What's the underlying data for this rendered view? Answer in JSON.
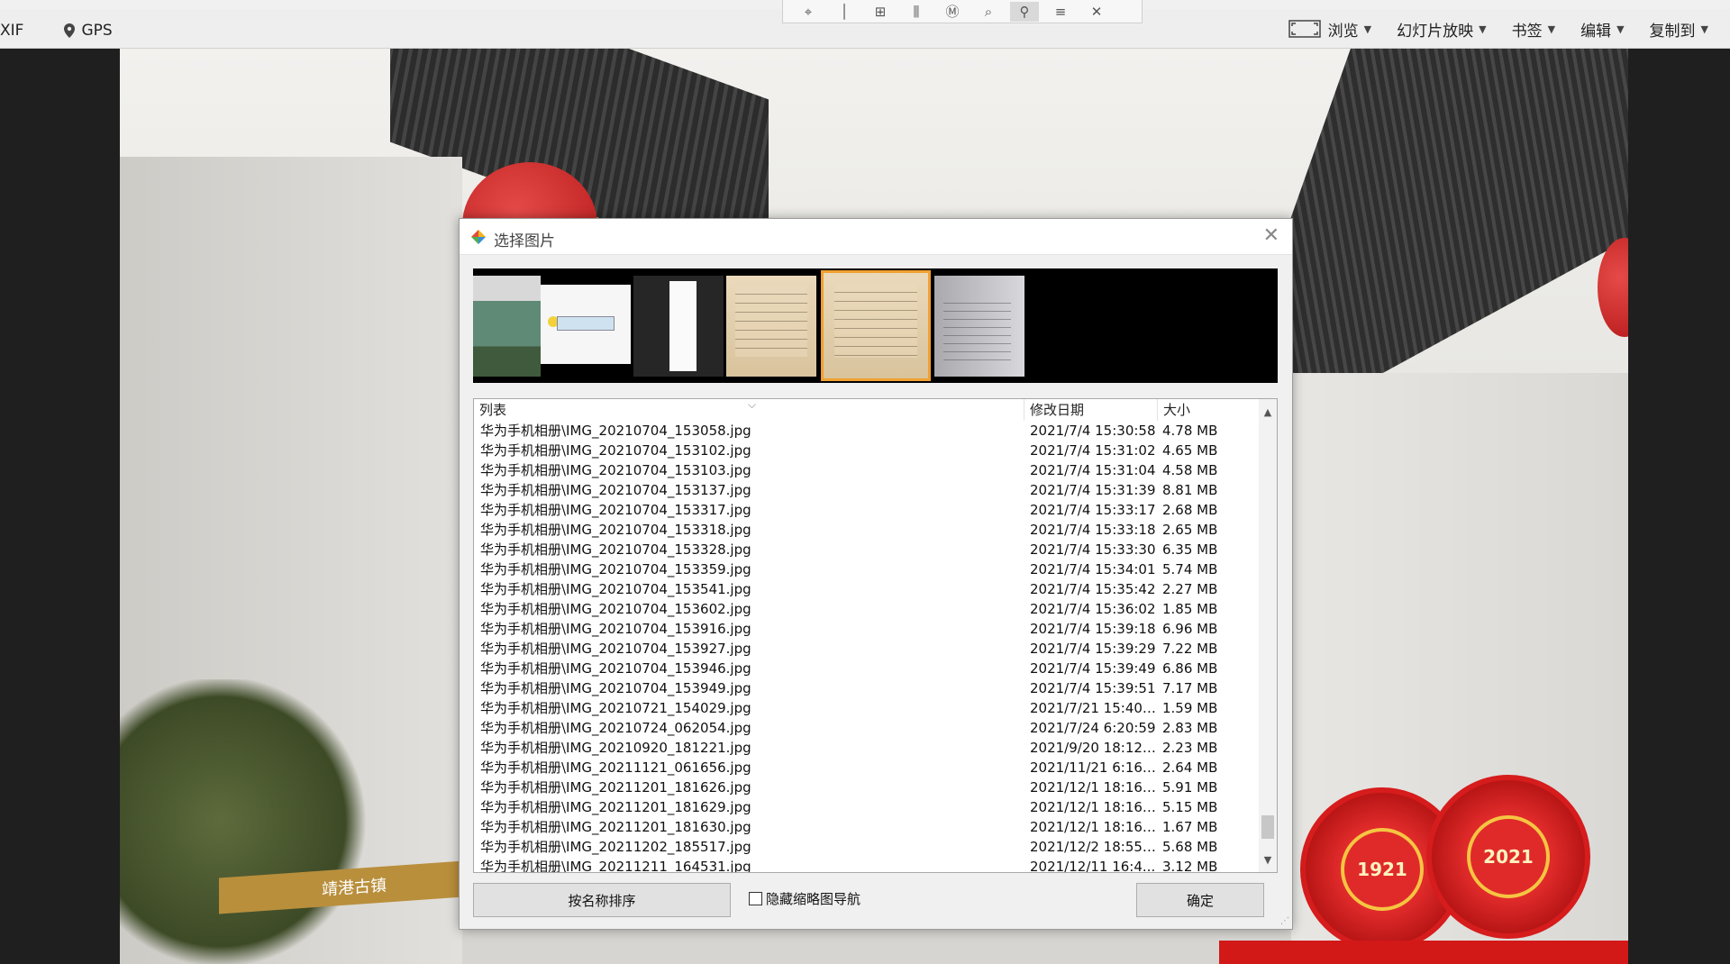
{
  "menubar": {
    "left_items": [
      {
        "label": "XIF",
        "icon": ""
      },
      {
        "label": "GPS",
        "icon": "pin-icon"
      }
    ],
    "right_items": [
      {
        "label": "浏览",
        "icon": "fullscreen-icon"
      },
      {
        "label": "幻灯片放映"
      },
      {
        "label": "书签"
      },
      {
        "label": "编辑"
      },
      {
        "label": "复制到"
      }
    ]
  },
  "toolbar_icons": [
    "crosshair-icon",
    "line-icon",
    "grid-icon",
    "bars-icon",
    "m-icon",
    "zoom-icon",
    "bike-icon",
    "menu-icon",
    "close-icon"
  ],
  "background_photo": {
    "sign_text": "靖港古镇",
    "wheel_years": [
      "1921",
      "2021"
    ]
  },
  "dialog": {
    "title": "选择图片",
    "list": {
      "headers": {
        "name": "列表",
        "date": "修改日期",
        "size": "大小"
      },
      "rows": [
        {
          "name": "华为手机相册\\IMG_20210704_153058.jpg",
          "date": "2021/7/4 15:30:58",
          "size": "4.78 MB"
        },
        {
          "name": "华为手机相册\\IMG_20210704_153102.jpg",
          "date": "2021/7/4 15:31:02",
          "size": "4.65 MB"
        },
        {
          "name": "华为手机相册\\IMG_20210704_153103.jpg",
          "date": "2021/7/4 15:31:04",
          "size": "4.58 MB"
        },
        {
          "name": "华为手机相册\\IMG_20210704_153137.jpg",
          "date": "2021/7/4 15:31:39",
          "size": "8.81 MB"
        },
        {
          "name": "华为手机相册\\IMG_20210704_153317.jpg",
          "date": "2021/7/4 15:33:17",
          "size": "2.68 MB"
        },
        {
          "name": "华为手机相册\\IMG_20210704_153318.jpg",
          "date": "2021/7/4 15:33:18",
          "size": "2.65 MB"
        },
        {
          "name": "华为手机相册\\IMG_20210704_153328.jpg",
          "date": "2021/7/4 15:33:30",
          "size": "6.35 MB"
        },
        {
          "name": "华为手机相册\\IMG_20210704_153359.jpg",
          "date": "2021/7/4 15:34:01",
          "size": "5.74 MB"
        },
        {
          "name": "华为手机相册\\IMG_20210704_153541.jpg",
          "date": "2021/7/4 15:35:42",
          "size": "2.27 MB"
        },
        {
          "name": "华为手机相册\\IMG_20210704_153602.jpg",
          "date": "2021/7/4 15:36:02",
          "size": "1.85 MB"
        },
        {
          "name": "华为手机相册\\IMG_20210704_153916.jpg",
          "date": "2021/7/4 15:39:18",
          "size": "6.96 MB"
        },
        {
          "name": "华为手机相册\\IMG_20210704_153927.jpg",
          "date": "2021/7/4 15:39:29",
          "size": "7.22 MB"
        },
        {
          "name": "华为手机相册\\IMG_20210704_153946.jpg",
          "date": "2021/7/4 15:39:49",
          "size": "6.86 MB"
        },
        {
          "name": "华为手机相册\\IMG_20210704_153949.jpg",
          "date": "2021/7/4 15:39:51",
          "size": "7.17 MB"
        },
        {
          "name": "华为手机相册\\IMG_20210721_154029.jpg",
          "date": "2021/7/21 15:40:...",
          "size": "1.59 MB"
        },
        {
          "name": "华为手机相册\\IMG_20210724_062054.jpg",
          "date": "2021/7/24 6:20:59",
          "size": "2.83 MB"
        },
        {
          "name": "华为手机相册\\IMG_20210920_181221.jpg",
          "date": "2021/9/20 18:12:...",
          "size": "2.23 MB"
        },
        {
          "name": "华为手机相册\\IMG_20211121_061656.jpg",
          "date": "2021/11/21 6:16:...",
          "size": "2.64 MB"
        },
        {
          "name": "华为手机相册\\IMG_20211201_181626.jpg",
          "date": "2021/12/1 18:16:...",
          "size": "5.91 MB"
        },
        {
          "name": "华为手机相册\\IMG_20211201_181629.jpg",
          "date": "2021/12/1 18:16:...",
          "size": "5.15 MB"
        },
        {
          "name": "华为手机相册\\IMG_20211201_181630.jpg",
          "date": "2021/12/1 18:16:...",
          "size": "1.67 MB"
        },
        {
          "name": "华为手机相册\\IMG_20211202_185517.jpg",
          "date": "2021/12/2 18:55:...",
          "size": "5.68 MB"
        },
        {
          "name": "华为手机相册\\IMG_20211211_164531.jpg",
          "date": "2021/12/11 16:4...",
          "size": "3.12 MB"
        }
      ]
    },
    "sort_button": "按名称排序",
    "hide_thumbnail_checkbox": {
      "label": "隐藏缩略图导航",
      "checked": false
    },
    "ok_button": "确定"
  }
}
